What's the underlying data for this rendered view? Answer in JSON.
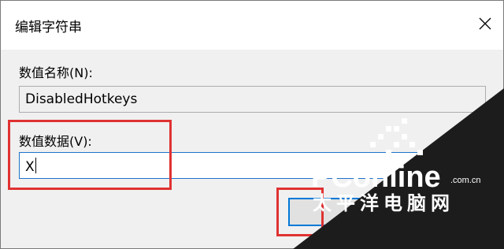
{
  "dialog": {
    "title": "编辑字符串",
    "close_icon": "close-icon"
  },
  "value_name": {
    "label": "数值名称(N):",
    "value": "DisabledHotkeys"
  },
  "value_data": {
    "label": "数值数据(V):",
    "value": "X"
  },
  "watermark": {
    "brand": "PConline",
    "domain": ".com.cn",
    "slogan": "太平洋电脑网"
  },
  "colors": {
    "highlight": "#e03232",
    "focus": "#0078d7"
  }
}
